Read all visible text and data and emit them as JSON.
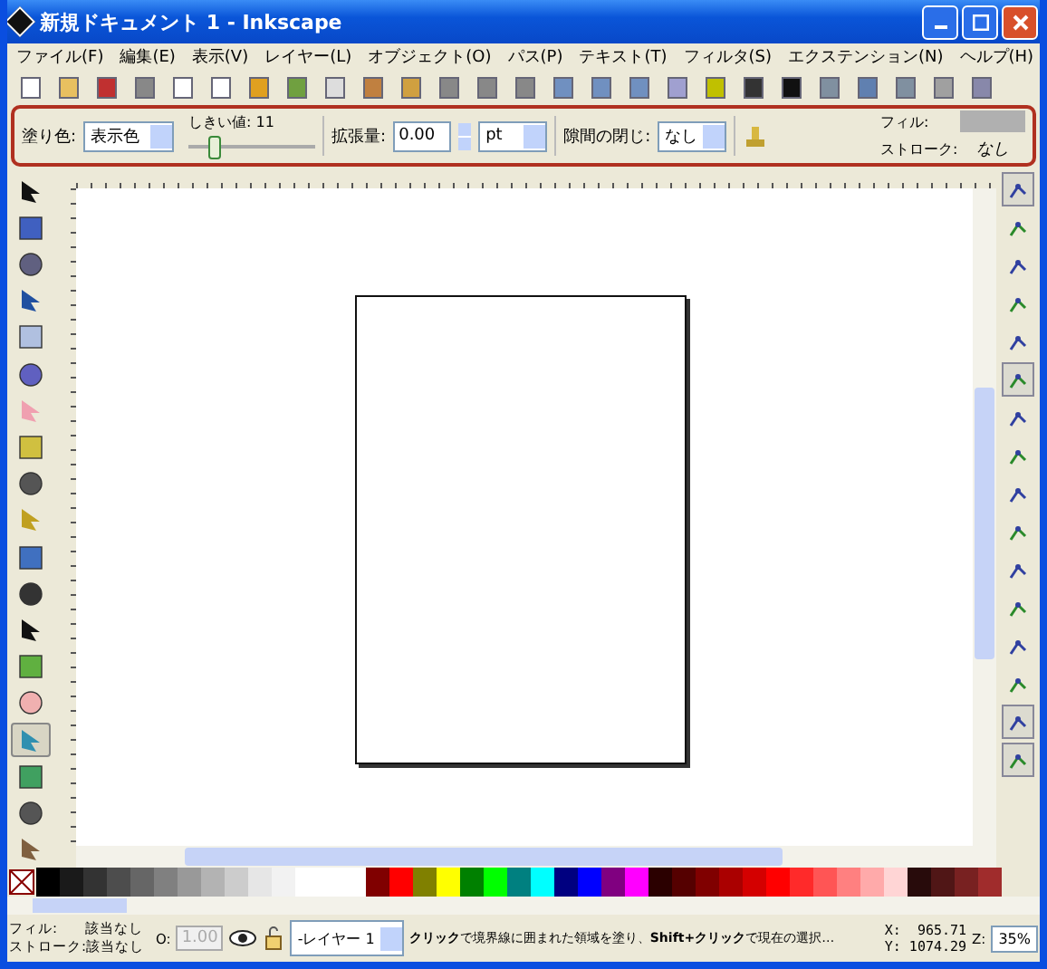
{
  "window": {
    "title": "新規ドキュメント 1 - Inkscape"
  },
  "menu": [
    "ファイル(F)",
    "編集(E)",
    "表示(V)",
    "レイヤー(L)",
    "オブジェクト(O)",
    "パス(P)",
    "テキスト(T)",
    "フィルタ(S)",
    "エクステンション(N)",
    "ヘルプ(H)"
  ],
  "tool_controls": {
    "fill_label": "塗り色:",
    "fill_value": "表示色",
    "threshold_label": "しきい値: 11",
    "threshold_slider": {
      "level": 0.15
    },
    "grow_label": "拡張量:",
    "grow_value": "0.00",
    "unit": "pt",
    "gaps_label": "隙間の閉じ:",
    "gaps_value": "なし",
    "style_fill_label": "フィル:",
    "style_stroke_label": "ストローク:",
    "style_stroke_value": "なし"
  },
  "tools": [
    {
      "selected": false
    },
    {
      "selected": false
    },
    {
      "selected": false
    },
    {
      "selected": false
    },
    {
      "selected": false
    },
    {
      "selected": false
    },
    {
      "selected": false
    },
    {
      "selected": false
    },
    {
      "selected": false
    },
    {
      "selected": false
    },
    {
      "selected": false
    },
    {
      "selected": false
    },
    {
      "selected": false
    },
    {
      "selected": false
    },
    {
      "selected": false
    },
    {
      "selected": true
    },
    {
      "selected": false
    },
    {
      "selected": false
    },
    {
      "selected": false
    }
  ],
  "snap": [
    {
      "selected": true
    },
    {
      "selected": false
    },
    {
      "selected": false
    },
    {
      "selected": false
    },
    {
      "selected": false
    },
    {
      "selected": true
    },
    {
      "selected": false
    },
    {
      "selected": false
    },
    {
      "selected": false
    },
    {
      "selected": false
    },
    {
      "selected": false
    },
    {
      "selected": false
    },
    {
      "selected": false
    },
    {
      "selected": false
    },
    {
      "selected": true
    },
    {
      "selected": true
    }
  ],
  "palette": [
    {
      "color": "#000000"
    },
    {
      "color": "#1a1a1a"
    },
    {
      "color": "#333333"
    },
    {
      "color": "#4d4d4d"
    },
    {
      "color": "#666666"
    },
    {
      "color": "#808080"
    },
    {
      "color": "#999999"
    },
    {
      "color": "#b3b3b3"
    },
    {
      "color": "#cccccc"
    },
    {
      "color": "#e6e6e6"
    },
    {
      "color": "#f2f2f2"
    },
    {
      "color": "#ffffff"
    },
    {
      "color": "#ffffff"
    },
    {
      "color": "#ffffff"
    },
    {
      "color": "#800000"
    },
    {
      "color": "#ff0000"
    },
    {
      "color": "#808000"
    },
    {
      "color": "#ffff00"
    },
    {
      "color": "#008000"
    },
    {
      "color": "#00ff00"
    },
    {
      "color": "#008080"
    },
    {
      "color": "#00ffff"
    },
    {
      "color": "#000080"
    },
    {
      "color": "#0000ff"
    },
    {
      "color": "#800080"
    },
    {
      "color": "#ff00ff"
    },
    {
      "color": "#2b0000"
    },
    {
      "color": "#550000"
    },
    {
      "color": "#800000"
    },
    {
      "color": "#aa0000"
    },
    {
      "color": "#d40000"
    },
    {
      "color": "#ff0000"
    },
    {
      "color": "#ff2a2a"
    },
    {
      "color": "#ff5555"
    },
    {
      "color": "#ff8080"
    },
    {
      "color": "#ffaaaa"
    },
    {
      "color": "#ffd5d5"
    },
    {
      "color": "#280b0b"
    },
    {
      "color": "#501616"
    },
    {
      "color": "#782121"
    },
    {
      "color": "#a02c2c"
    }
  ],
  "status": {
    "fill_label": "フィル:",
    "fill_value": "該当なし",
    "stroke_label": "ストローク:",
    "stroke_value": "該当なし",
    "opacity_label": "O:",
    "opacity_value": "1.00",
    "opacity_disabled": true,
    "layer": "-レイヤー 1",
    "message": "**クリック**で境界線に囲まれた領域を塗り、**Shift+クリック**で現在の選択…",
    "x": "X:  965.71",
    "y": "Y: 1074.29",
    "zoom_label": "Z:",
    "zoom": "35%"
  }
}
